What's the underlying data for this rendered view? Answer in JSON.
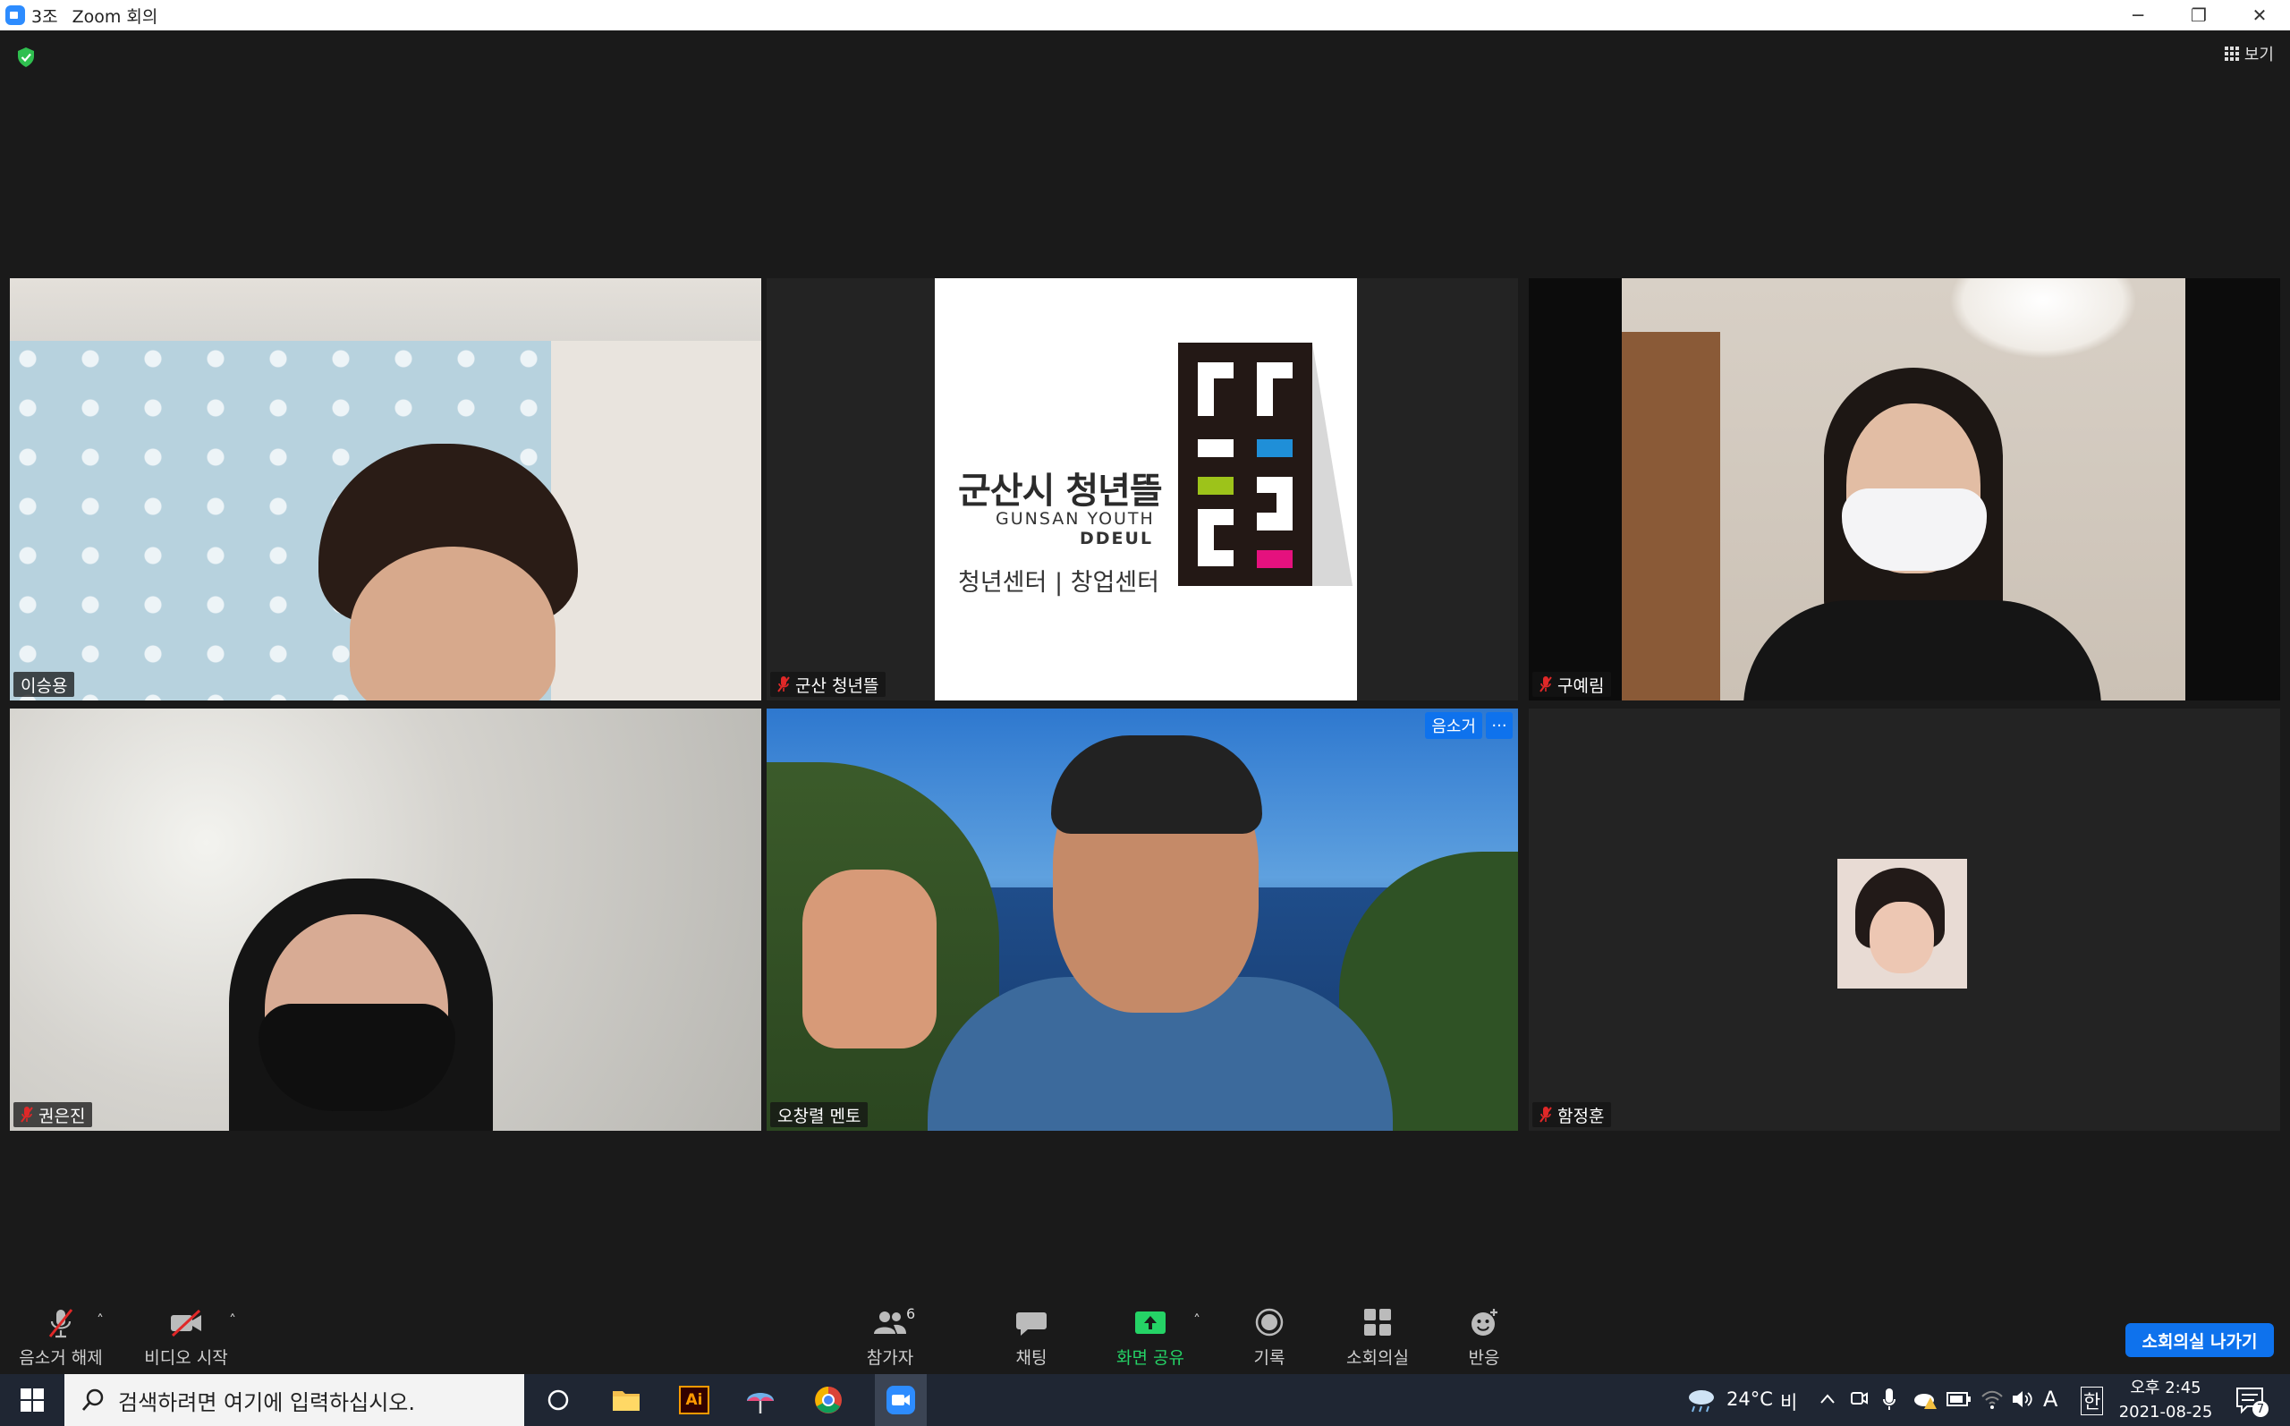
{
  "window": {
    "room": "3조",
    "app": "Zoom 회의",
    "minimize": "─",
    "restore": "❐",
    "close": "✕"
  },
  "top": {
    "view_label": "보기"
  },
  "participants": [
    {
      "name": "이승용",
      "muted": false
    },
    {
      "name": "군산 청년뜰",
      "muted": true
    },
    {
      "name": "구예림",
      "muted": true
    },
    {
      "name": "권은진",
      "muted": true
    },
    {
      "name": "오창렬 멘토",
      "muted": false,
      "active": true
    },
    {
      "name": "함정훈",
      "muted": true
    }
  ],
  "logo": {
    "title": "군산시 청년뜰",
    "en_line1": "GUNSAN YOUTH",
    "en_line2": "DDEUL",
    "sub": "청년센터 | 창업센터"
  },
  "active_tile": {
    "mute_chip": "음소거",
    "more_chip": "···"
  },
  "toolbar": {
    "unmute": "음소거 해제",
    "video": "비디오 시작",
    "participants": "참가자",
    "participants_count": "6",
    "chat": "채팅",
    "share": "화면 공유",
    "record": "기록",
    "breakout": "소회의실",
    "reactions": "반응",
    "leave": "소회의실 나가기",
    "caret": "˄"
  },
  "taskbar": {
    "search_placeholder": "검색하려면 여기에 입력하십시오.",
    "weather_temp": "24°C",
    "weather_desc": "비",
    "ime_a": "A",
    "ime_han": "한",
    "time": "오후 2:45",
    "date": "2021-08-25",
    "notif_count": "7",
    "ai_label": "Ai"
  },
  "colors": {
    "accent_blue": "#0e72ed",
    "active_border": "#e6ef7a",
    "share_green": "#25d366",
    "mute_red": "#e02828"
  }
}
